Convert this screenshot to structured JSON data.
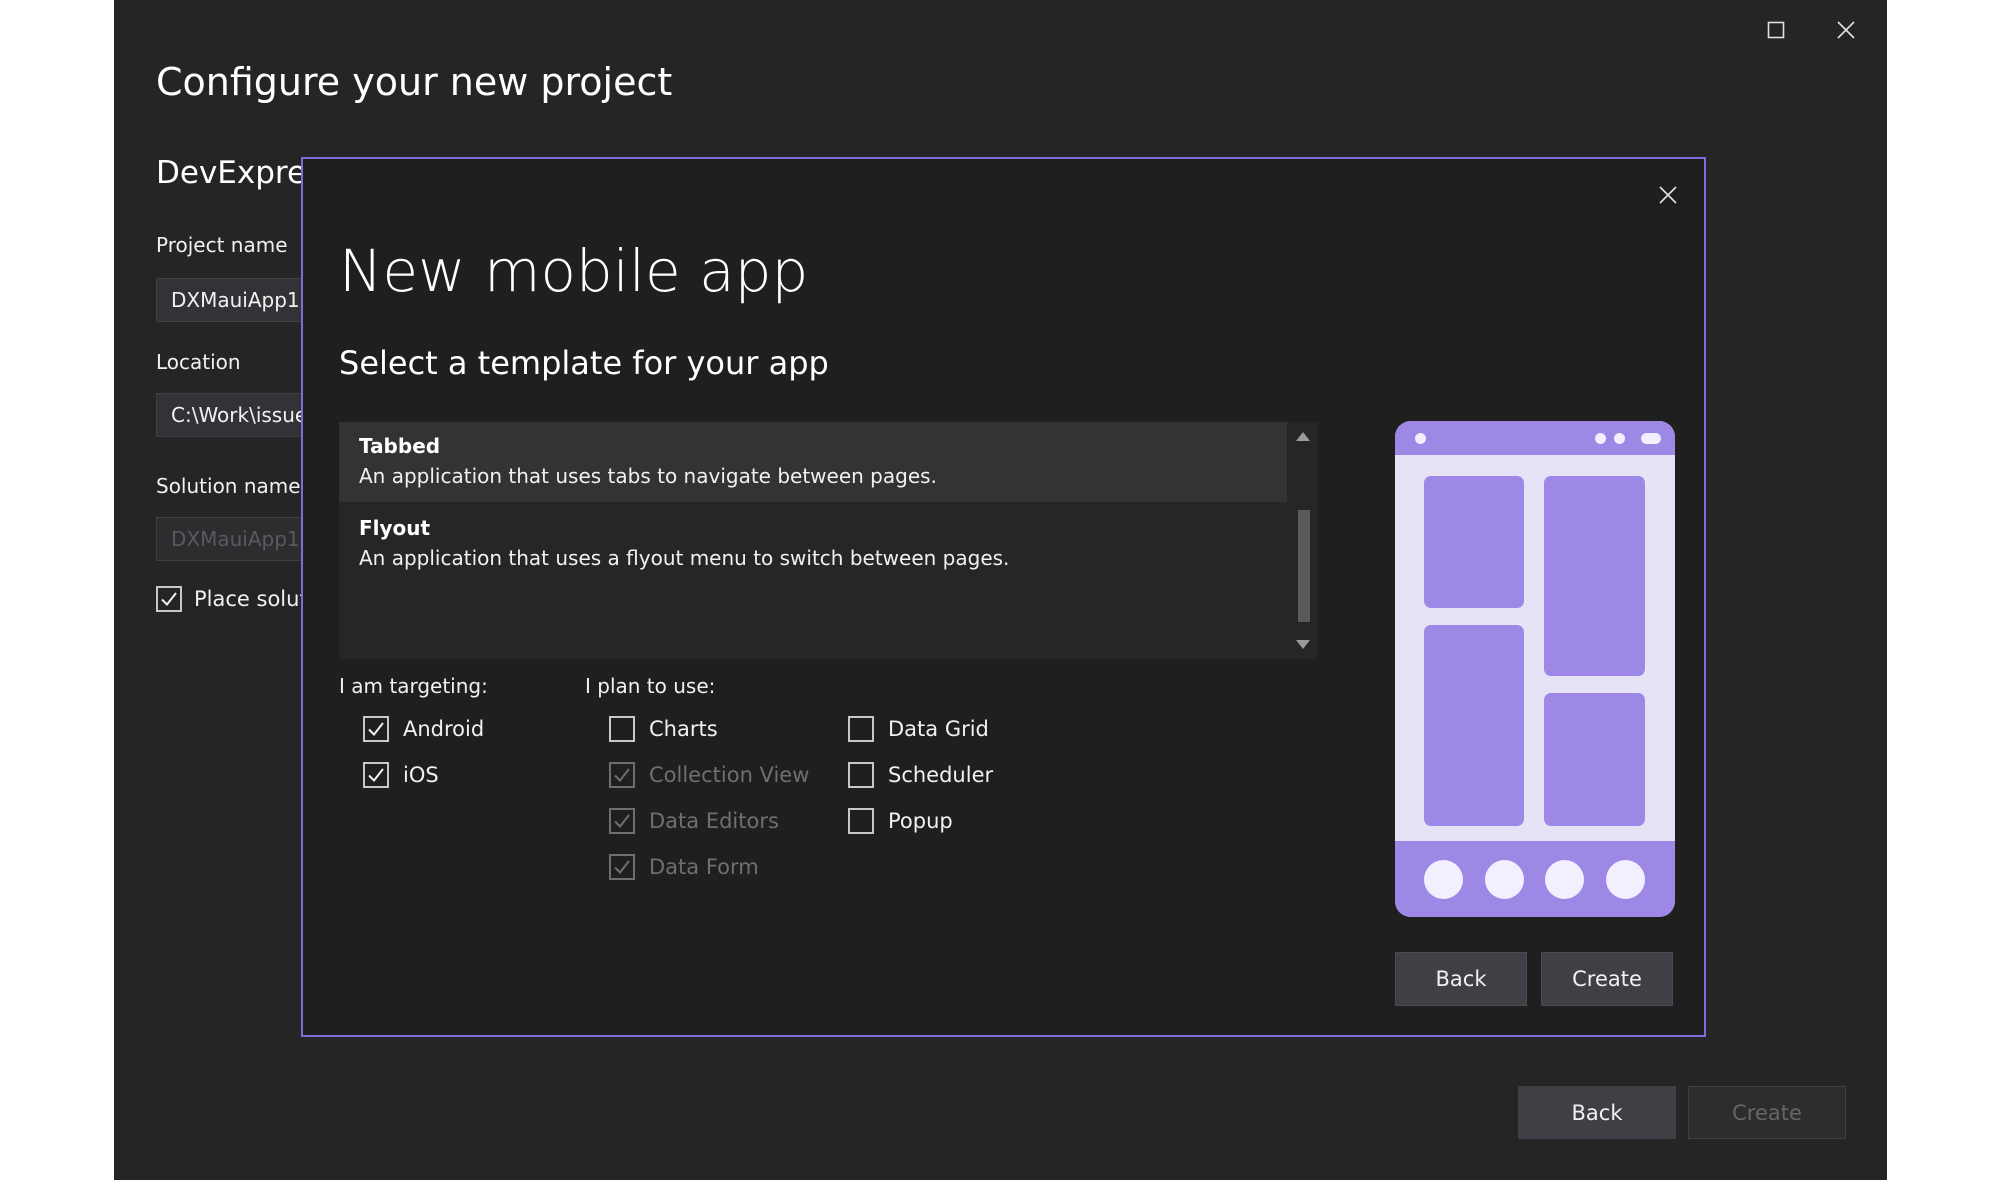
{
  "window": {
    "title": "Configure your new project",
    "subtitle": "DevExpres",
    "project_name_label": "Project name",
    "project_name_value": "DXMauiApp1",
    "location_label": "Location",
    "location_value": "C:\\Work\\issue",
    "solution_name_label": "Solution name",
    "solution_name_value": "DXMauiApp1",
    "place_solution_label": "Place soluti",
    "place_solution_checked": true,
    "back_label": "Back",
    "create_label": "Create",
    "icons": {
      "maximize": "maximize-icon",
      "close": "close-icon"
    }
  },
  "modal": {
    "title": "New mobile app",
    "subtitle": "Select a template for your app",
    "templates": [
      {
        "name": "Tabbed",
        "description": "An application that uses tabs to navigate between pages.",
        "selected": true
      },
      {
        "name": "Flyout",
        "description": "An application that uses a flyout menu to switch between pages.",
        "selected": false
      }
    ],
    "targeting_label": "I am targeting:",
    "targeting": [
      {
        "label": "Android",
        "checked": true
      },
      {
        "label": "iOS",
        "checked": true
      }
    ],
    "plan_label": "I plan to use:",
    "plan_options": [
      {
        "label": "Charts",
        "checked": false,
        "disabled": false
      },
      {
        "label": "Collection View",
        "checked": true,
        "disabled": true
      },
      {
        "label": "Data Editors",
        "checked": true,
        "disabled": true
      },
      {
        "label": "Data Form",
        "checked": true,
        "disabled": true
      },
      {
        "label": "Data Grid",
        "checked": false,
        "disabled": false
      },
      {
        "label": "Scheduler",
        "checked": false,
        "disabled": false
      },
      {
        "label": "Popup",
        "checked": false,
        "disabled": false
      }
    ],
    "back_label": "Back",
    "create_label": "Create",
    "colors": {
      "accent": "#7b6ed6",
      "preview_fill": "#9d88e6",
      "preview_bg": "#e6e3f7"
    }
  }
}
